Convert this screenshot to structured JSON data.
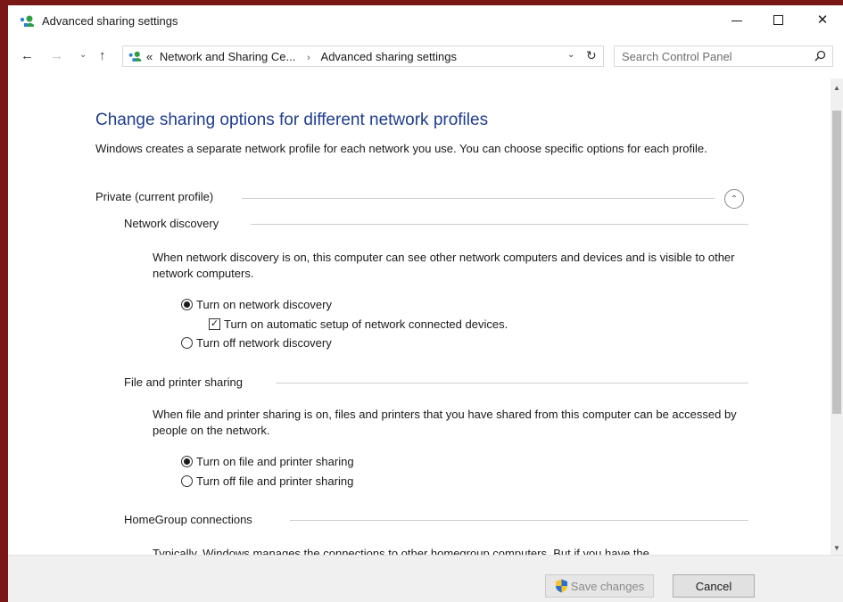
{
  "window": {
    "title": "Advanced sharing settings",
    "minimize_glyph": "",
    "maximize_glyph": "",
    "close_glyph": "✕"
  },
  "nav": {
    "back_glyph": "←",
    "forward_glyph": "→",
    "recent_glyph": "⌄",
    "up_glyph": "↑",
    "breadcrumb": {
      "overflow": "«",
      "item1": "Network and Sharing Ce...",
      "separator": "›",
      "item2": "Advanced sharing settings"
    },
    "dropdown_glyph": "⌄",
    "refresh_glyph": "↻"
  },
  "search": {
    "placeholder": "Search Control Panel"
  },
  "content": {
    "heading": "Change sharing options for different network profiles",
    "intro": "Windows creates a separate network profile for each network you use. You can choose specific options for each profile.",
    "profile": {
      "label": "Private (current profile)",
      "collapse_glyph": "⌃"
    },
    "network_discovery": {
      "title": "Network discovery",
      "description": "When network discovery is on, this computer can see other network computers and devices and is visible to other network computers.",
      "option_on": "Turn on network discovery",
      "option_auto_setup": "Turn on automatic setup of network connected devices.",
      "option_off": "Turn off network discovery",
      "selected": "on",
      "auto_setup_checked": true
    },
    "file_printer_sharing": {
      "title": "File and printer sharing",
      "description": "When file and printer sharing is on, files and printers that you have shared from this computer can be accessed by people on the network.",
      "option_on": "Turn on file and printer sharing",
      "option_off": "Turn off file and printer sharing",
      "selected": "on"
    },
    "homegroup": {
      "title": "HomeGroup connections",
      "description": "Typically, Windows manages the connections to other homegroup computers. But if you have the"
    }
  },
  "footer": {
    "save_label": "Save changes",
    "cancel_label": "Cancel"
  },
  "colors": {
    "heading": "#1e3d8f",
    "desktop_border": "#7a1818"
  },
  "icons": {
    "app": "network-sharing-icon",
    "search": "search-icon",
    "save": "uac-shield-icon"
  }
}
